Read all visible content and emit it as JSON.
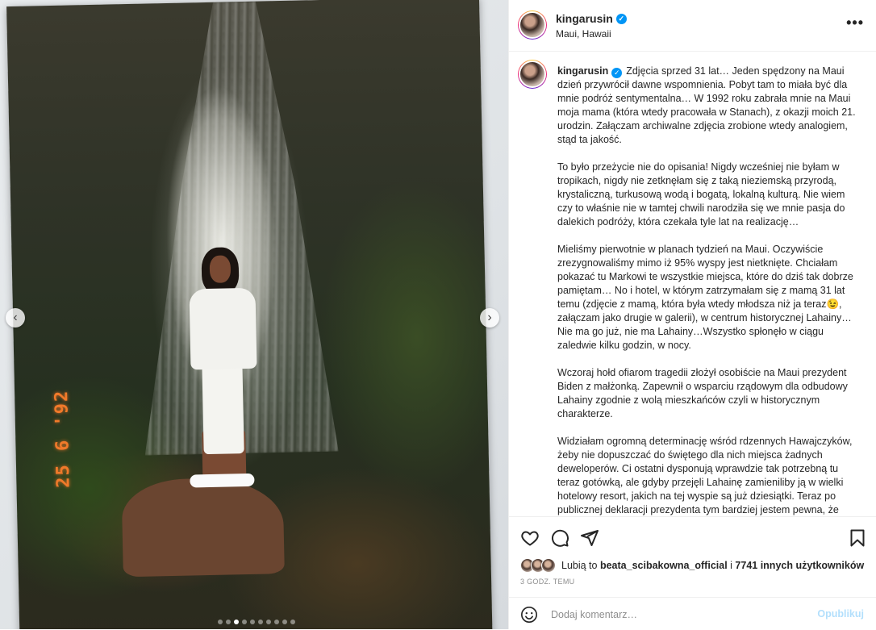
{
  "photo": {
    "date_stamp": "25 6 '92",
    "carousel": {
      "slide_count": 10,
      "active_index": 2
    }
  },
  "post": {
    "username": "kingarusin",
    "location": "Maui, Hawaii",
    "more_glyph": "•••",
    "caption_paragraphs": [
      "Zdjęcia sprzed 31 lat… Jeden spędzony na Maui dzień przywrócił dawne wspomnienia. Pobyt tam to miała być dla mnie podróż sentymentalna… W 1992 roku zabrała mnie na Maui moja mama (która wtedy pracowała w Stanach), z okazji moich 21. urodzin. Załączam archiwalne zdjęcia zrobione wtedy analogiem, stąd ta jakość.",
      "To było przeżycie nie do opisania! Nigdy wcześniej nie byłam w tropikach, nigdy nie zetknęłam się z taką nieziemską przyrodą, krystaliczną, turkusową wodą i bogatą, lokalną kulturą. Nie wiem czy to właśnie nie w tamtej chwili narodziła się we mnie pasja do dalekich podróży, która czekała tyle lat na realizację…",
      "Mieliśmy pierwotnie w planach tydzień na Maui. Oczywiście zrezygnowaliśmy mimo iż 95% wyspy jest nietknięte. Chciałam pokazać tu Markowi te wszystkie miejsca, które do dziś tak dobrze pamiętam… No i hotel, w którym zatrzymałam się z mamą 31 lat temu (zdjęcie z mamą, która była wtedy młodsza niż ja teraz😉, załączam jako drugie w galerii), w centrum historycznej Lahainy… Nie ma go już, nie ma Lahainy…Wszystko spłonęło w ciągu zaledwie kilku godzin, w nocy.",
      "Wczoraj hołd ofiarom tragedii złożył osobiście na Maui prezydent Biden z małżonką. Zapewnił o wsparciu rządowym dla odbudowy Lahainy zgodnie z wolą mieszkańców czyli w historycznym charakterze.",
      "Widziałam ogromną determinację wśród rdzennych Hawajczyków, żeby nie dopuszczać do świętego dla nich miejsca żadnych deweloperów. Ci ostatni dysponują wprawdzie tak potrzebną tu teraz gotówką, ale gdyby przejęli Lahainę zamieniliby ją w wielki hotelowy resort, jakich na tej wyspie są już dziesiątki. Teraz po publicznej deklaracji prezydenta tym bardziej jestem pewna, że Hawajczycy odbudują miasto na własnych zasadach, że stanie się"
    ],
    "likes": {
      "prefix": "Lubią to",
      "user": "beata_scibakowna_official",
      "joiner": "i",
      "others": "7741 innych użytkowników"
    },
    "time_ago": "3 GODZ. TEMU",
    "comment": {
      "placeholder": "Dodaj komentarz…",
      "value": "",
      "post_label": "Opublikuj"
    }
  },
  "icons": {
    "like": "heart-icon",
    "comment": "comment-icon",
    "share": "share-icon",
    "save": "bookmark-icon",
    "emoji": "emoji-icon",
    "prev": "chevron-left-icon",
    "next": "chevron-right-icon",
    "verified": "verified-badge-icon"
  },
  "colors": {
    "accent_blue": "#0095f6",
    "post_disabled": "#b2dffc",
    "secondary_text": "#8e8e8e",
    "primary_text": "#262626",
    "date_stamp": "#f07a2a"
  }
}
